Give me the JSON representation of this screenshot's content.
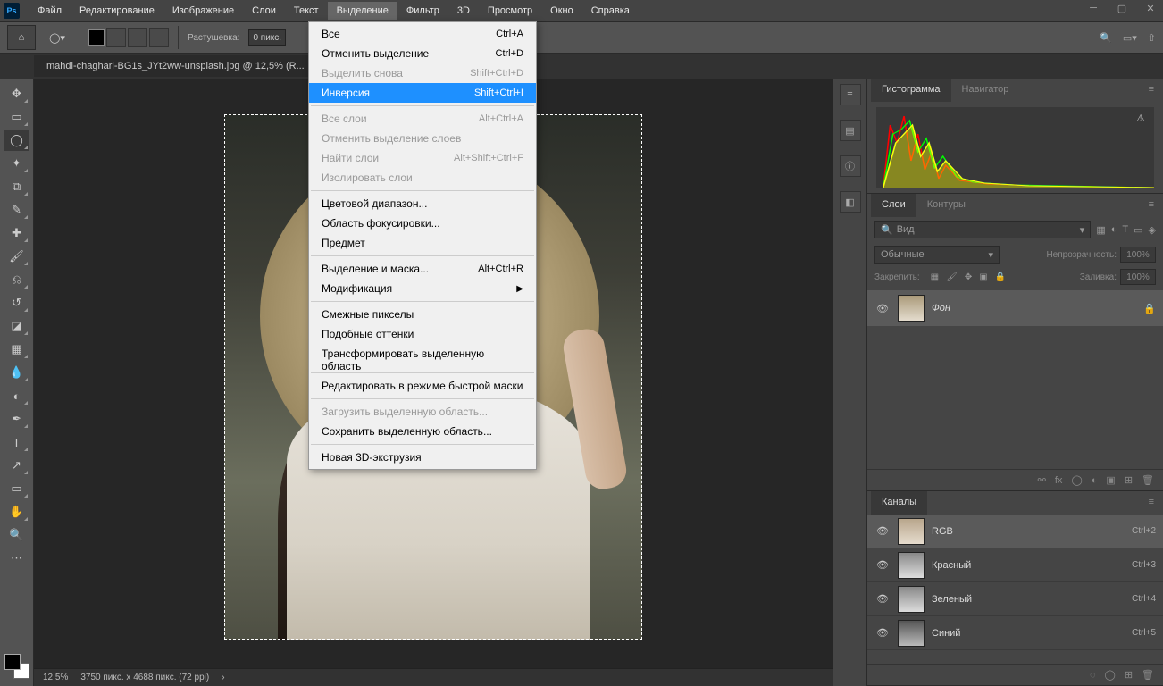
{
  "menu": {
    "items": [
      "Файл",
      "Редактирование",
      "Изображение",
      "Слои",
      "Текст",
      "Выделение",
      "Фильтр",
      "3D",
      "Просмотр",
      "Окно",
      "Справка"
    ],
    "open_index": 5
  },
  "optbar": {
    "feather_label": "Растушевка:",
    "feather_value": "0 пикс."
  },
  "doc": {
    "tab_title": "mahdi-chaghari-BG1s_JYt2ww-unsplash.jpg @ 12,5% (R..."
  },
  "status": {
    "zoom": "12,5%",
    "dims": "3750 пикс. x 4688 пикс. (72 ppi)"
  },
  "panels": {
    "hist_tab": "Гистограмма",
    "nav_tab": "Навигатор",
    "layers_tab": "Слои",
    "paths_tab": "Контуры",
    "channels_tab": "Каналы",
    "search_placeholder": "Вид",
    "blend_mode": "Обычные",
    "opacity_label": "Непрозрачность:",
    "opacity_value": "100%",
    "lock_label": "Закрепить:",
    "fill_label": "Заливка:",
    "fill_value": "100%",
    "layer_name": "Фон",
    "channels": [
      {
        "name": "RGB",
        "shortcut": "Ctrl+2",
        "cls": "ch-rgb"
      },
      {
        "name": "Красный",
        "shortcut": "Ctrl+3",
        "cls": "ch-r"
      },
      {
        "name": "Зеленый",
        "shortcut": "Ctrl+4",
        "cls": "ch-g"
      },
      {
        "name": "Синий",
        "shortcut": "Ctrl+5",
        "cls": "ch-b"
      }
    ]
  },
  "dropdown": [
    {
      "type": "item",
      "label": "Все",
      "shortcut": "Ctrl+A"
    },
    {
      "type": "item",
      "label": "Отменить выделение",
      "shortcut": "Ctrl+D"
    },
    {
      "type": "item",
      "label": "Выделить снова",
      "shortcut": "Shift+Ctrl+D",
      "disabled": true
    },
    {
      "type": "item",
      "label": "Инверсия",
      "shortcut": "Shift+Ctrl+I",
      "hover": true
    },
    {
      "type": "sep"
    },
    {
      "type": "item",
      "label": "Все слои",
      "shortcut": "Alt+Ctrl+A",
      "disabled": true
    },
    {
      "type": "item",
      "label": "Отменить выделение слоев",
      "disabled": true
    },
    {
      "type": "item",
      "label": "Найти слои",
      "shortcut": "Alt+Shift+Ctrl+F",
      "disabled": true
    },
    {
      "type": "item",
      "label": "Изолировать слои",
      "disabled": true
    },
    {
      "type": "sep"
    },
    {
      "type": "item",
      "label": "Цветовой диапазон..."
    },
    {
      "type": "item",
      "label": "Область фокусировки..."
    },
    {
      "type": "item",
      "label": "Предмет"
    },
    {
      "type": "sep"
    },
    {
      "type": "item",
      "label": "Выделение и маска...",
      "shortcut": "Alt+Ctrl+R"
    },
    {
      "type": "submenu",
      "label": "Модификация"
    },
    {
      "type": "sep"
    },
    {
      "type": "item",
      "label": "Смежные пикселы"
    },
    {
      "type": "item",
      "label": "Подобные оттенки"
    },
    {
      "type": "sep"
    },
    {
      "type": "item",
      "label": "Трансформировать выделенную область"
    },
    {
      "type": "sep"
    },
    {
      "type": "item",
      "label": "Редактировать в режиме быстрой маски"
    },
    {
      "type": "sep"
    },
    {
      "type": "item",
      "label": "Загрузить выделенную область...",
      "disabled": true
    },
    {
      "type": "item",
      "label": "Сохранить выделенную область..."
    },
    {
      "type": "sep"
    },
    {
      "type": "item",
      "label": "Новая 3D-экструзия"
    }
  ]
}
